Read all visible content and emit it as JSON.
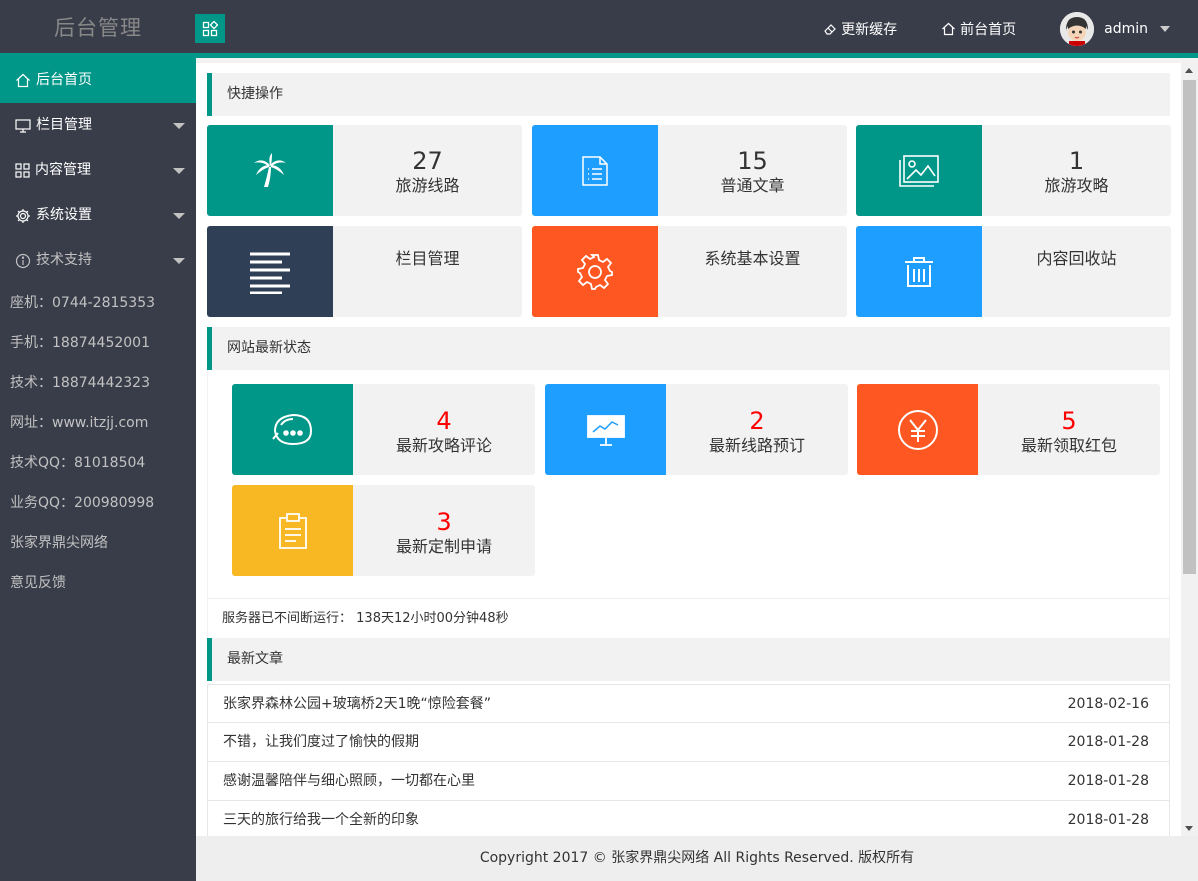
{
  "header": {
    "logo": "后台管理",
    "refresh_cache": "更新缓存",
    "frontend_home": "前台首页",
    "username": "admin"
  },
  "sidebar": {
    "items": [
      {
        "label": "后台首页",
        "icon": "home-icon"
      },
      {
        "label": "栏目管理",
        "icon": "monitor-icon"
      },
      {
        "label": "内容管理",
        "icon": "apps-icon"
      },
      {
        "label": "系统设置",
        "icon": "gear-icon"
      },
      {
        "label": "技术支持",
        "icon": "info-icon"
      }
    ],
    "info": [
      "座机：0744-2815353",
      "手机：18874452001",
      "技术：18874442323",
      "网址：www.itzjj.com",
      "技术QQ：81018504",
      "业务QQ：200980998",
      "张家界鼎尖网络",
      "意见反馈"
    ]
  },
  "quick": {
    "title": "快捷操作",
    "cards": [
      {
        "num": "27",
        "label": "旅游线路",
        "icon": "palm-tree-icon",
        "color": "#009688"
      },
      {
        "num": "15",
        "label": "普通文章",
        "icon": "document-icon",
        "color": "#1e9fff"
      },
      {
        "num": "1",
        "label": "旅游攻略",
        "icon": "image-icon",
        "color": "#009688"
      },
      {
        "label": "栏目管理",
        "icon": "lines-icon",
        "color": "#2f4056"
      },
      {
        "label": "系统基本设置",
        "icon": "gear-icon",
        "color": "#ff5722"
      },
      {
        "label": "内容回收站",
        "icon": "trash-icon",
        "color": "#1e9fff"
      }
    ]
  },
  "status": {
    "title": "网站最新状态",
    "cards": [
      {
        "num": "4",
        "label": "最新攻略评论",
        "icon": "chat-icon",
        "color": "#009688"
      },
      {
        "num": "2",
        "label": "最新线路预订",
        "icon": "presentation-icon",
        "color": "#1e9fff"
      },
      {
        "num": "5",
        "label": "最新领取红包",
        "icon": "yen-icon",
        "color": "#ff5722"
      },
      {
        "num": "3",
        "label": "最新定制申请",
        "icon": "clipboard-icon",
        "color": "#f7b824"
      }
    ],
    "uptime_label": "服务器已不间断运行：",
    "uptime_value": "138天12小时00分钟48秒"
  },
  "articles": {
    "title": "最新文章",
    "rows": [
      {
        "title": "张家界森林公园+玻璃桥2天1晚“惊险套餐”",
        "date": "2018-02-16"
      },
      {
        "title": "不错，让我们度过了愉快的假期",
        "date": "2018-01-28"
      },
      {
        "title": "感谢温馨陪伴与细心照顾，一切都在心里",
        "date": "2018-01-28"
      },
      {
        "title": "三天的旅行给我一个全新的印象",
        "date": "2018-01-28"
      }
    ]
  },
  "footer": "Copyright 2017 © 张家界鼎尖网络 All Rights Reserved. 版权所有"
}
